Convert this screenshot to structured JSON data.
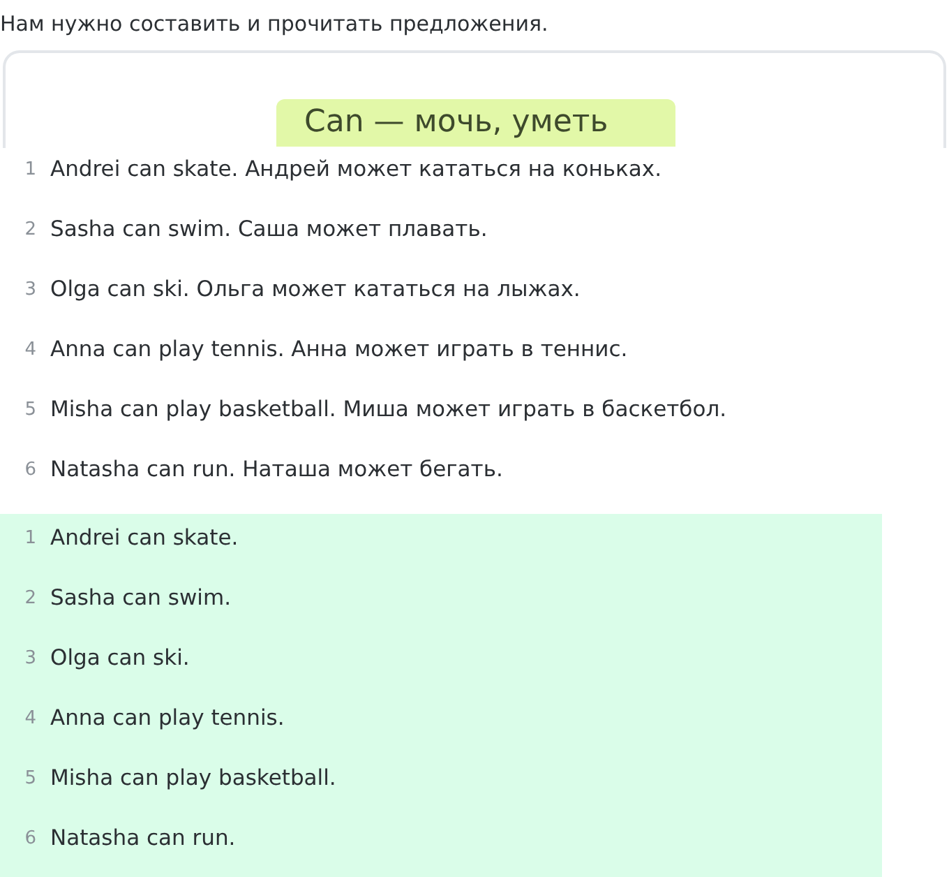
{
  "intro": "Нам нужно составить и прочитать предложения.",
  "rule_card": {
    "highlight": "Can — мочь, уметь"
  },
  "sentences": [
    {
      "number": "1",
      "text": "Andrei can skate. Андрей может кататься на коньках."
    },
    {
      "number": "2",
      "text": "Sasha can swim. Саша может плавать."
    },
    {
      "number": "3",
      "text": "Olga can ski. Ольга может кататься на лыжах."
    },
    {
      "number": "4",
      "text": "Anna can play tennis. Анна может играть в теннис."
    },
    {
      "number": "5",
      "text": "Misha can play basketball. Миша может играть в баскетбол."
    },
    {
      "number": "6",
      "text": "Natasha can run. Наташа может бегать."
    }
  ],
  "answers": [
    {
      "number": "1",
      "text": "Andrei can skate."
    },
    {
      "number": "2",
      "text": "Sasha can swim."
    },
    {
      "number": "3",
      "text": "Olga can ski."
    },
    {
      "number": "4",
      "text": "Anna can play tennis."
    },
    {
      "number": "5",
      "text": "Misha can play basketball."
    },
    {
      "number": "6",
      "text": "Natasha can run."
    }
  ]
}
